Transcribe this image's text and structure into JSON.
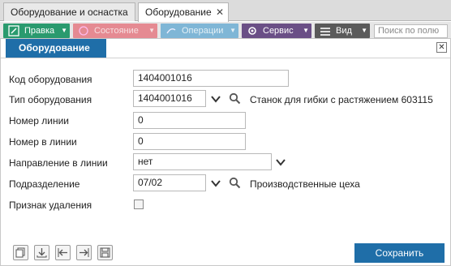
{
  "tabs": [
    {
      "label": "Оборудование и оснастка"
    },
    {
      "label": "Оборудование"
    }
  ],
  "toolbar": {
    "edit": "Правка",
    "state": "Состояние",
    "operations": "Операции",
    "service": "Сервис",
    "view": "Вид",
    "search_placeholder": "Поиск по полю"
  },
  "dialog": {
    "title": "Оборудование",
    "fields": {
      "code": {
        "label": "Код оборудования",
        "value": "1404001016"
      },
      "type": {
        "label": "Тип оборудования",
        "value": "1404001016",
        "description": "Станок для гибки с растяжением 603115"
      },
      "line_number": {
        "label": "Номер линии",
        "value": "0"
      },
      "number_in_line": {
        "label": "Номер в линии",
        "value": "0"
      },
      "direction": {
        "label": "Направление в линии",
        "value": "нет"
      },
      "division": {
        "label": "Подразделение",
        "value": "07/02",
        "description": "Производственные цеха"
      },
      "deleted": {
        "label": "Признак удаления",
        "checked": false
      }
    },
    "save_label": "Сохранить"
  },
  "icons": {
    "close": "close-icon",
    "chevron": "chevron-down-icon",
    "search": "magnifier-icon"
  },
  "colors": {
    "accent": "#1f6ea8",
    "edit": "#2a9a6e",
    "state": "#e58a92",
    "operations": "#7fb6d6",
    "service": "#6a4f86",
    "view": "#5a5a5a"
  }
}
